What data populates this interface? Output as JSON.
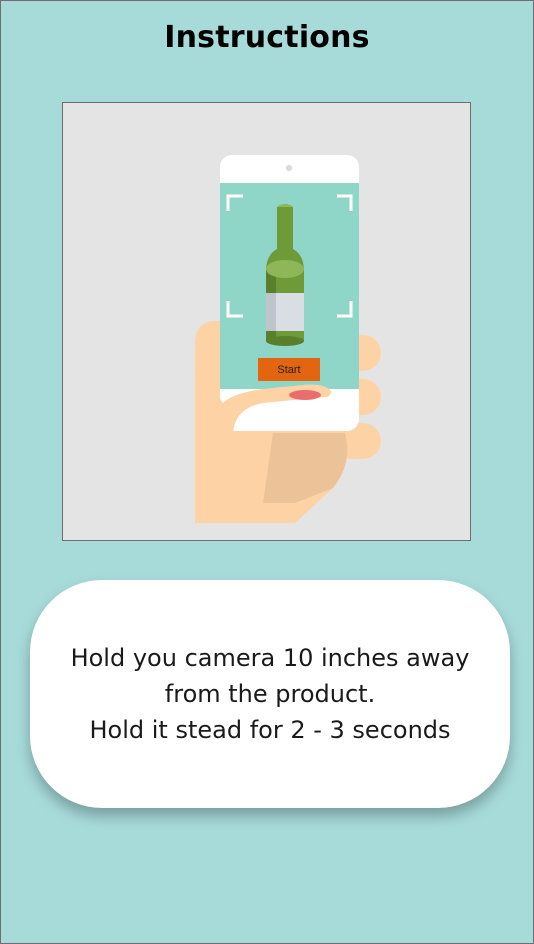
{
  "page": {
    "title": "Instructions"
  },
  "illustration": {
    "start_label": "Start",
    "icon": "phone-scanning-bottle-illustration",
    "colors": {
      "panel_background": "#e4e4e4",
      "phone_body": "#ffffff",
      "phone_screen": "#8fd6c9",
      "hand": "#fdd3a5",
      "hand_shadow": "#ecc398",
      "bottle": "#6f9a38",
      "bottle_dark": "#5a7f2b",
      "bottle_label": "#d9dde4",
      "start_button": "#e4650f"
    }
  },
  "instruction_card": {
    "lines": [
      "Hold you camera 10 inches away",
      "from the product.",
      "Hold it stead for 2 - 3 seconds"
    ]
  },
  "colors": {
    "background": "#a7dbda",
    "card": "#ffffff",
    "title_text": "#000000"
  }
}
